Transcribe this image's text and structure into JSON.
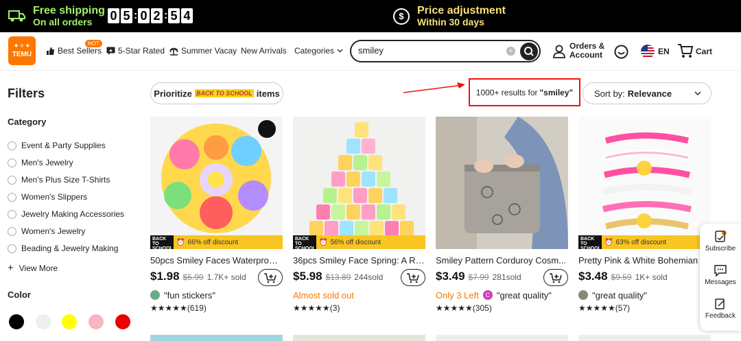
{
  "topbar": {
    "shipping_line1": "Free shipping",
    "shipping_line2": "On all orders",
    "timer_digits": [
      "0",
      "5",
      "0",
      "2",
      "5",
      "4"
    ],
    "price_line1": "Price adjustment",
    "price_line2": "Within 30 days"
  },
  "nav": {
    "logo": "TEMU",
    "best_sellers": "Best Sellers",
    "hot_badge": "HOT",
    "five_star": "5-Star Rated",
    "summer": "Summer Vacay",
    "new_arrivals": "New Arrivals",
    "categories": "Categories",
    "search_value": "smiley",
    "orders_line1": "Orders &",
    "orders_line2": "Account",
    "lang": "EN",
    "cart": "Cart"
  },
  "filters": {
    "title": "Filters",
    "category_title": "Category",
    "categories": [
      "Event & Party Supplies",
      "Men's Jewelry",
      "Men's Plus Size T-Shirts",
      "Women's Slippers",
      "Jewelry Making Accessories",
      "Women's Jewelry",
      "Beading & Jewelry Making"
    ],
    "view_more": "View More",
    "color_title": "Color",
    "colors": [
      "#000000",
      "#eeeeee",
      "#ffff00",
      "#f7b6c2",
      "#ee0000"
    ]
  },
  "toolbar": {
    "prioritize_prefix": "Prioritize",
    "prioritize_badge": "BACK TO SCHOOL",
    "prioritize_suffix": "items",
    "results_prefix": "1000+ results for",
    "results_query": "\"smiley\"",
    "sort_prefix": "Sort by:",
    "sort_value": "Relevance"
  },
  "products": [
    {
      "name": "50pcs Smiley Faces Waterproof...",
      "price": "$1.98",
      "orig": "$5.99",
      "sold": "1.7K+ sold",
      "discount": "66% off discount",
      "tag": "\"fun stickers\"",
      "note": "",
      "rating": "(619)"
    },
    {
      "name": "36pcs Smiley Face Spring: A Ra...",
      "price": "$5.98",
      "orig": "$13.89",
      "sold": "244sold",
      "discount": "56% off discount",
      "tag": "",
      "note": "Almost sold out",
      "rating": "(3)"
    },
    {
      "name": "Smiley Pattern Corduroy Cosm...",
      "price": "$3.49",
      "orig": "$7.99",
      "sold": "281sold",
      "discount": "",
      "tag": "\"great quality\"",
      "note": "Only 3 Left",
      "rating": "(305)"
    },
    {
      "name": "Pretty Pink & White Bohemian",
      "price": "$3.48",
      "orig": "$9.59",
      "sold": "1K+ sold",
      "discount": "63% off discount",
      "tag": "\"great quality\"",
      "note": "",
      "rating": "(57)"
    }
  ],
  "promo_tag": "BACK TO SCHOOL",
  "stars": "★★★★★",
  "rightbar": {
    "subscribe": "Subscribe",
    "messages": "Messages",
    "feedback": "Feedback"
  },
  "theme": {
    "accent": "#fb7701",
    "shipping_green": "#a3f06b",
    "promo_yellow": "#f8c522"
  }
}
